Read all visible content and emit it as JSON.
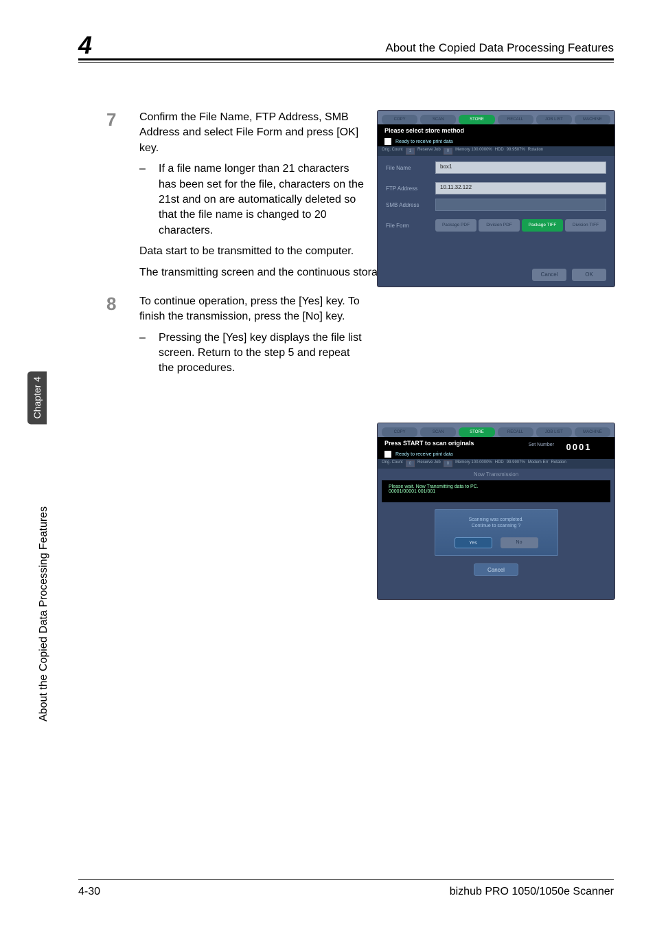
{
  "header": {
    "chapter_num": "4",
    "title": "About the Copied Data Processing Features"
  },
  "sidebar": {
    "tab": "Chapter 4",
    "vertical_text": "About the Copied Data Processing Features"
  },
  "steps": [
    {
      "num": "7",
      "main": "Confirm the File Name, FTP Address, SMB Address and select File Form and press [OK] key.",
      "bullet": "If a file name longer than 21 characters has been set for the file,  characters on the 21st and on are automatically deleted so that the file name is changed to 20 characters.",
      "continuation1": "Data start to be transmitted to the computer.",
      "continuation2": "The transmitting screen and the continuous storage confirmation screen appears."
    },
    {
      "num": "8",
      "main": "To continue operation, press the [Yes] key. To finish the transmission, press the [No] key.",
      "bullet": "Pressing the [Yes] key displays the file list screen. Return to the step 5 and repeat the procedures."
    }
  ],
  "screenshot1": {
    "tabs": [
      "COPY",
      "SCAN",
      "STORE",
      "RECALL",
      "JOB LIST",
      "MACHINE"
    ],
    "header": "Please select store method",
    "subheader": "Ready to receive print data",
    "status": {
      "orig_count": "Orig. Count",
      "orig_val": "1",
      "reserve": "Reserve Job",
      "reserve_val": "0",
      "memory": "Memory  100.0000%",
      "hdd": "HDD",
      "hdd_val": "99.9507%",
      "rotation": "Rotation"
    },
    "file_name_label": "File Name",
    "file_name_value": "box1",
    "ftp_label": "FTP Address",
    "ftp_value": "10.11.32.122",
    "smb_label": "SMB Address",
    "smb_value": "",
    "file_form_label": "File Form",
    "file_form_options": [
      "Package PDF",
      "Division PDF",
      "Package TIFF",
      "Division TIFF"
    ],
    "cancel": "Cancel",
    "ok": "OK"
  },
  "screenshot2": {
    "tabs": [
      "COPY",
      "SCAN",
      "STORE",
      "RECALL",
      "JOB LIST",
      "MACHINE"
    ],
    "header": "Press START to scan originals",
    "set_number_label": "Set Number",
    "set_number": "0001",
    "subheader": "Ready to receive print data",
    "status": {
      "orig_count": "Orig. Count",
      "orig_val": "0",
      "reserve": "Reserve Job",
      "reserve_val": "0",
      "memory": "Memory  100.0000%",
      "hdd": "HDD",
      "hdd_val": "99.9907%",
      "modem": "Modem Err",
      "rotation": "Rotation"
    },
    "section": "Now Transmission",
    "black_line1": "Please wait.  Now Transmitting data to PC.",
    "black_line2": "00001/00001 001/001",
    "dialog_text1": "Scanning was completed.",
    "dialog_text2": "Continue to scanning ?",
    "yes": "Yes",
    "no": "No",
    "cancel": "Cancel"
  },
  "footer": {
    "page": "4-30",
    "product": "bizhub PRO 1050/1050e Scanner"
  }
}
